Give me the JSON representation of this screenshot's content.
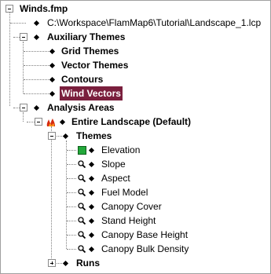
{
  "tree": {
    "root": "Winds.fmp",
    "landscape_file": "C:\\Workspace\\FlamMap6\\Tutorial\\Landscape_1.lcp",
    "auxiliary": {
      "label": "Auxiliary Themes",
      "items": [
        "Grid Themes",
        "Vector Themes",
        "Contours",
        "Wind Vectors"
      ],
      "selected": "Wind Vectors"
    },
    "analysis": {
      "label": "Analysis Areas",
      "area": "Entire Landscape (Default)",
      "themes_label": "Themes",
      "themes": [
        "Elevation",
        "Slope",
        "Aspect",
        "Fuel Model",
        "Canopy Cover",
        "Stand Height",
        "Canopy Base Height",
        "Canopy Bulk Density"
      ],
      "runs_label": "Runs"
    }
  },
  "colors": {
    "selection_bg": "#7a1f3d",
    "elevation_icon": "#22a83a"
  },
  "icons": {
    "expanded_box": "minus-box-icon",
    "collapsed_box": "plus-box-icon",
    "node": "diamond-icon",
    "elevation": "green-square-icon",
    "theme": "magnifier-icon",
    "area": "fire-icon"
  }
}
